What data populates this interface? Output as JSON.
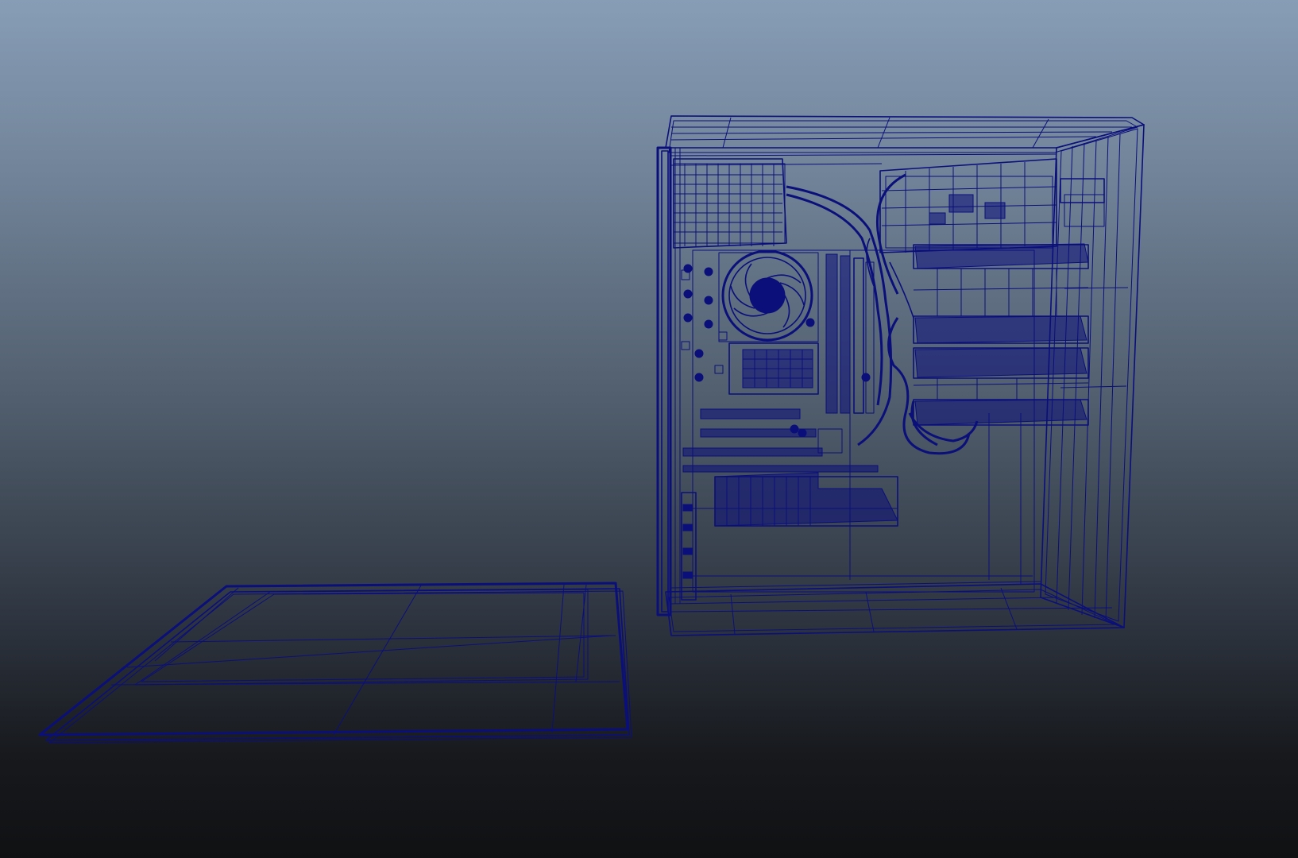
{
  "viewport": {
    "background_top": "#879db6",
    "background_bottom": "#101113",
    "wireframe_color": "#0b0f7a",
    "display_mode": "wireframe"
  },
  "scene_objects": [
    {
      "name": "pc-tower-case",
      "kind": "mesh"
    },
    {
      "name": "side-panel",
      "kind": "mesh"
    }
  ]
}
